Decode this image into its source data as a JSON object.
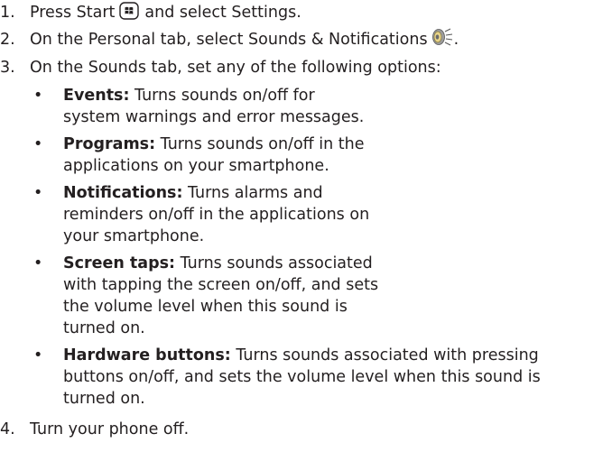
{
  "steps": [
    {
      "number": "1.",
      "before": "Press Start",
      "after": "and select Settings."
    },
    {
      "number": "2.",
      "before": "On the Personal tab, select Sounds & Notifications",
      "after": "."
    },
    {
      "number": "3.",
      "text": "On the Sounds tab, set any of the following options:"
    },
    {
      "number": "4.",
      "text": "Turn your phone off."
    }
  ],
  "bullet_glyph": "•",
  "options": [
    {
      "term": "Events:",
      "lines": [
        " Turns sounds on/off for",
        "system warnings and error messages."
      ]
    },
    {
      "term": "Programs:",
      "lines": [
        " Turns sounds on/off in the",
        "applications on your smartphone."
      ]
    },
    {
      "term": "Notifications:",
      "lines": [
        " Turns alarms and",
        "reminders on/off in the applications on",
        "your smartphone."
      ]
    },
    {
      "term": "Screen taps:",
      "lines": [
        " Turns sounds associated",
        "with tapping the screen on/off, and sets",
        "the volume level when this sound is",
        "turned on."
      ]
    },
    {
      "term": "Hardware buttons:",
      "lines": [
        " Turns sounds associated with pressing",
        "buttons on/off, and sets the volume level when this sound is",
        "turned on."
      ]
    }
  ],
  "icons": {
    "start": "windows-start-icon",
    "sounds": "speaker-sounds-icon"
  },
  "colors": {
    "text": "#231f20",
    "icon_outline": "#231f20",
    "speaker_body": "#e8d48a",
    "speaker_cone": "#9c9c9c"
  }
}
